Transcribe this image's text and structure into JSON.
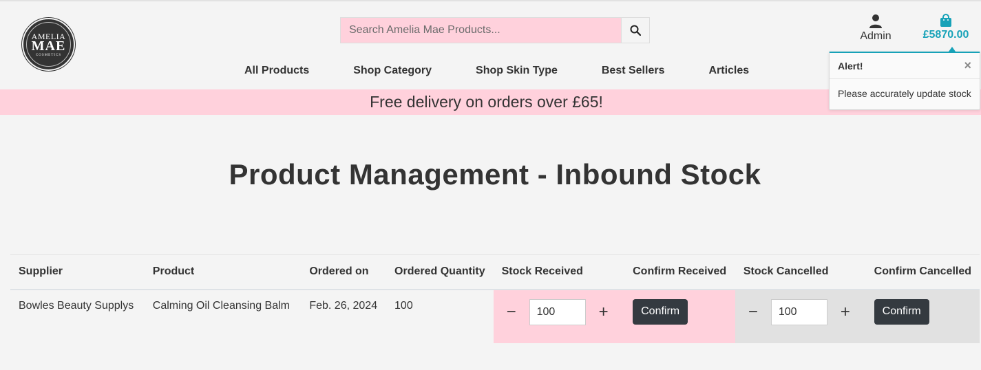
{
  "logo": {
    "line1": "AMELIA",
    "line2": "MAE",
    "line3": "COSMETICS"
  },
  "search": {
    "placeholder": "Search Amelia Mae Products..."
  },
  "account": {
    "label": "Admin"
  },
  "cart": {
    "total": "£5870.00"
  },
  "nav": [
    "All Products",
    "Shop Category",
    "Shop Skin Type",
    "Best Sellers",
    "Articles"
  ],
  "banner": {
    "text": "Free delivery on orders over £65!"
  },
  "alert": {
    "title": "Alert!",
    "close": "×",
    "message": "Please accurately update stock"
  },
  "page": {
    "title": "Product Management - Inbound Stock"
  },
  "table": {
    "headers": [
      "Supplier",
      "Product",
      "Ordered on",
      "Ordered Quantity",
      "Stock Received",
      "Confirm Received",
      "Stock Cancelled",
      "Confirm Cancelled"
    ],
    "rows": [
      {
        "supplier": "Bowles Beauty Supplys",
        "product": "Calming Oil Cleansing Balm",
        "ordered_on": "Feb. 26, 2024",
        "ordered_quantity": "100",
        "stock_received": "100",
        "stock_cancelled": "100",
        "confirm_label": "Confirm",
        "minus": "−",
        "plus": "+"
      }
    ]
  },
  "colors": {
    "accent": "#17a2b8",
    "pink": "#ffd1dc",
    "dark": "#343a40",
    "text": "#333333"
  },
  "icons": {
    "search": "search-icon",
    "user": "user-icon",
    "bag": "shopping-bag-icon"
  }
}
